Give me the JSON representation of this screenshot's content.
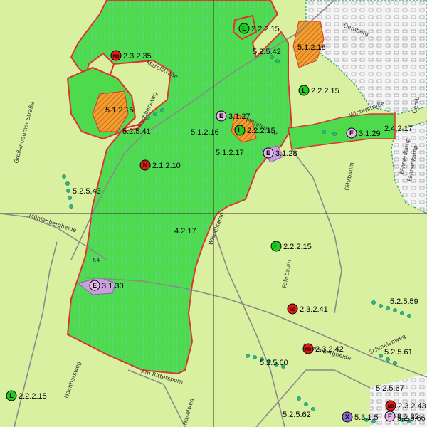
{
  "map": {
    "colors": {
      "background": "#d9f0a0",
      "protected_area": "#4ddb4d",
      "boundary": "#e03030",
      "hatch": "#f0a030",
      "eingriff": "#c9a0dc",
      "grid_line": "#333333",
      "tree_marker": "#2fb58a",
      "settlement": "#f4f4f4"
    },
    "streets": {
      "mittelstrasse_n": "Mittelstraße",
      "mittelstrasse_c": "Mittelstraße",
      "nachbarsweg_n": "Nachbarsweg",
      "nachbarsweg_s": "Nachbarsweg",
      "grossenbaumer": "Großenbaumer Straße",
      "muehlenbergheide_w": "Mühlenbergheide",
      "muehlenbergheide_e": "Mühlenbergheide",
      "k4": "K4",
      "wispelkamp": "Wispelkamp",
      "faehrbaum_n": "Fährbaum",
      "faehrbaum_s": "Fährbaum",
      "winterstrasse": "Winterstraße",
      "oemberg": "Oemberg",
      "oemb": "Oemb",
      "faehnenkamp_1": "Fähnenkamp",
      "faehnenkamp_2": "Fähnenkamp",
      "schmelenweg": "Schmelenweg",
      "am_rittersporn": "Am Rittersporn",
      "haselweg": "Haselweg"
    },
    "markers": [
      {
        "type": "L",
        "label": "2.2.2.15"
      },
      {
        "type": "ND",
        "label": "2.3.2.35"
      },
      {
        "type": "L",
        "label": "2.2.2.15"
      },
      {
        "type": "E",
        "label": "3.1.27"
      },
      {
        "type": "L",
        "label": "2.2.2.15"
      },
      {
        "type": "E",
        "label": "3.1.28"
      },
      {
        "type": "E",
        "label": "3.1.29"
      },
      {
        "type": "N",
        "label": "2.1.2.10"
      },
      {
        "type": "L",
        "label": "2.2.2.15"
      },
      {
        "type": "E",
        "label": "3.1.30"
      },
      {
        "type": "ND",
        "label": "2.3.2.41"
      },
      {
        "type": "ND",
        "label": "2.3.2.42"
      },
      {
        "type": "L",
        "label": "2.2.2.15"
      },
      {
        "type": "ND",
        "label": "2.3.2.43"
      },
      {
        "type": "E",
        "label": "3.1.32"
      },
      {
        "type": "X",
        "label": "5.3.1.5"
      }
    ],
    "area_labels": {
      "a1": "5.1.2.18",
      "a2": "5.2.5.42",
      "a3": "5.1.2.15",
      "a4": "5.2.5.41",
      "a5": "5.1.2.16",
      "a6": "5.1.2.17",
      "a7": "2.4.2.17",
      "a8": "5.2.5.43",
      "a9": "4.2.17",
      "a10": "5.2.5.59",
      "a11": "5.2.5.61",
      "a12": "5.2.5.60",
      "a13": "5.2.5.67",
      "a14": "5.2.5.62",
      "a15": "5.2.5.66"
    }
  }
}
